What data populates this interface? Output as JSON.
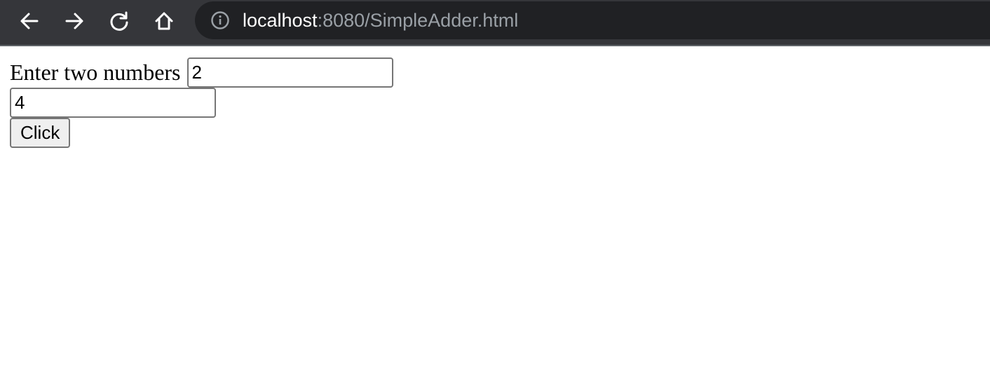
{
  "browser": {
    "url_host": "localhost",
    "url_rest": ":8080/SimpleAdder.html",
    "icons": [
      "back-arrow-icon",
      "forward-arrow-icon",
      "reload-icon",
      "home-icon",
      "info-icon"
    ]
  },
  "page": {
    "label": "Enter two numbers",
    "first_number": "2",
    "second_number": "4",
    "button_label": "Click"
  },
  "colors": {
    "toolbar": "#35363a",
    "omnibox": "#202124",
    "url_host": "#ffffff",
    "url_rest": "#9aa0a6"
  }
}
